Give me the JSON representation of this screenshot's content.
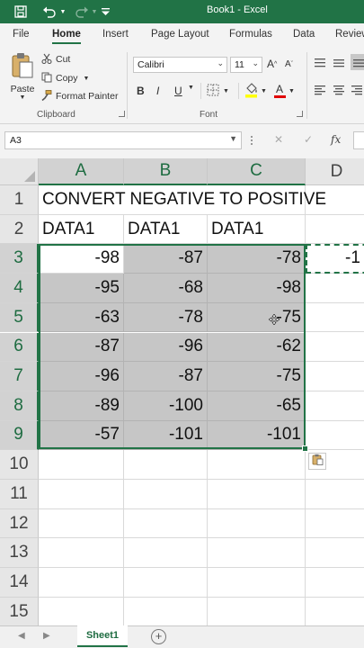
{
  "app": {
    "title": "Book1 - Excel",
    "accent": "#217346"
  },
  "quick_access": {
    "icons": [
      "save-icon",
      "undo-icon",
      "redo-icon",
      "customize-icon"
    ]
  },
  "ribbon": {
    "tabs": [
      {
        "label": "File"
      },
      {
        "label": "Home",
        "active": true
      },
      {
        "label": "Insert"
      },
      {
        "label": "Page Layout"
      },
      {
        "label": "Formulas"
      },
      {
        "label": "Data"
      },
      {
        "label": "Review"
      }
    ],
    "clipboard": {
      "paste_label": "Paste",
      "cut_label": "Cut",
      "copy_label": "Copy",
      "format_painter_label": "Format Painter",
      "group_label": "Clipboard"
    },
    "font": {
      "font_name": "Calibri",
      "font_size": "11",
      "group_label": "Font",
      "bold": "B",
      "italic": "I",
      "underline": "U",
      "increase_size": "A",
      "decrease_size": "A",
      "font_color_glyph": "A"
    }
  },
  "formula_bar": {
    "name_box": "A3",
    "fx": "fx",
    "cancel": "✕",
    "enter": "✓"
  },
  "grid": {
    "columns": [
      "A",
      "B",
      "C",
      "D"
    ],
    "rows": [
      "1",
      "2",
      "3",
      "4",
      "5",
      "6",
      "7",
      "8",
      "9",
      "10",
      "11",
      "12",
      "13",
      "14",
      "15"
    ],
    "title_cell": "CONVERT NEGATIVE TO POSITIVE",
    "headers": [
      "DATA1",
      "DATA1",
      "DATA1"
    ],
    "values": [
      [
        "-98",
        "-87",
        "-78"
      ],
      [
        "-95",
        "-68",
        "-98"
      ],
      [
        "-63",
        "-78",
        "-75"
      ],
      [
        "-87",
        "-96",
        "-62"
      ],
      [
        "-96",
        "-87",
        "-75"
      ],
      [
        "-89",
        "-100",
        "-65"
      ],
      [
        "-57",
        "-101",
        "-101"
      ]
    ],
    "d3_value": "-1"
  },
  "sheets": {
    "tabs": [
      "Sheet1"
    ],
    "add_label": "+"
  }
}
